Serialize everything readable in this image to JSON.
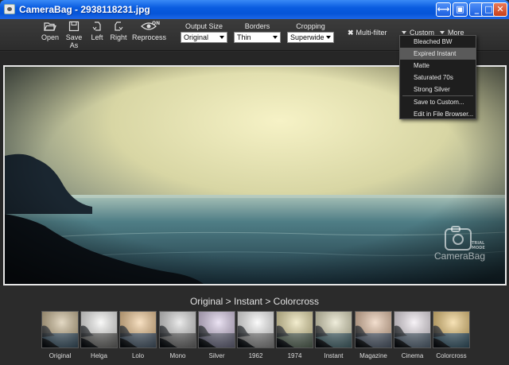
{
  "window": {
    "title": "CameraBag - 2938118231.jpg",
    "buttons": [
      "⟷",
      "▣",
      "_",
      "□",
      "✕"
    ]
  },
  "toolbar": {
    "open": "Open",
    "save_as": "Save As",
    "left": "Left",
    "right": "Right",
    "reprocess": "Reprocess",
    "reprocess_state": "ON",
    "output_size": {
      "label": "Output Size",
      "value": "Original"
    },
    "borders": {
      "label": "Borders",
      "value": "Thin"
    },
    "cropping": {
      "label": "Cropping",
      "value": "Superwide"
    },
    "multifilter": "Multi-filter",
    "custom": "Custom",
    "more": "More"
  },
  "custom_menu": {
    "items": [
      "Bleached BW",
      "Expired Instant",
      "Matte",
      "Saturated 70s",
      "Strong Silver"
    ],
    "highlighted": "Expired Instant",
    "actions": [
      "Save to Custom...",
      "Edit in File Browser..."
    ]
  },
  "watermark": {
    "brand": "CameraBag",
    "mode_line1": "TRIAL",
    "mode_line2": "MODE"
  },
  "filter_path": "Original > Instant > Colorcross",
  "filmstrip": [
    {
      "label": "Original",
      "sky": "#c9b48a",
      "sea": "#3e5666"
    },
    {
      "label": "Helga",
      "sky": "#f4f4f2",
      "sea": "#6a6a68"
    },
    {
      "label": "Lolo",
      "sky": "#f2c58a",
      "sea": "#4a5a6a"
    },
    {
      "label": "Mono",
      "sky": "#d8d8d8",
      "sea": "#6c6c6c"
    },
    {
      "label": "Silver",
      "sky": "#d8c8e8",
      "sea": "#6a6a80"
    },
    {
      "label": "1962",
      "sky": "#f8f8f8",
      "sea": "#8a8a8a"
    },
    {
      "label": "1974",
      "sky": "#e8dca0",
      "sea": "#5a6a5a"
    },
    {
      "label": "Instant",
      "sky": "#e0dcb8",
      "sea": "#4a6a70"
    },
    {
      "label": "Magazine",
      "sky": "#e8c0a0",
      "sea": "#556070"
    },
    {
      "label": "Cinema",
      "sky": "#f0e8f0",
      "sea": "#5a6a7a"
    },
    {
      "label": "Colorcross",
      "sky": "#f0c870",
      "sea": "#3a5a6a"
    }
  ]
}
